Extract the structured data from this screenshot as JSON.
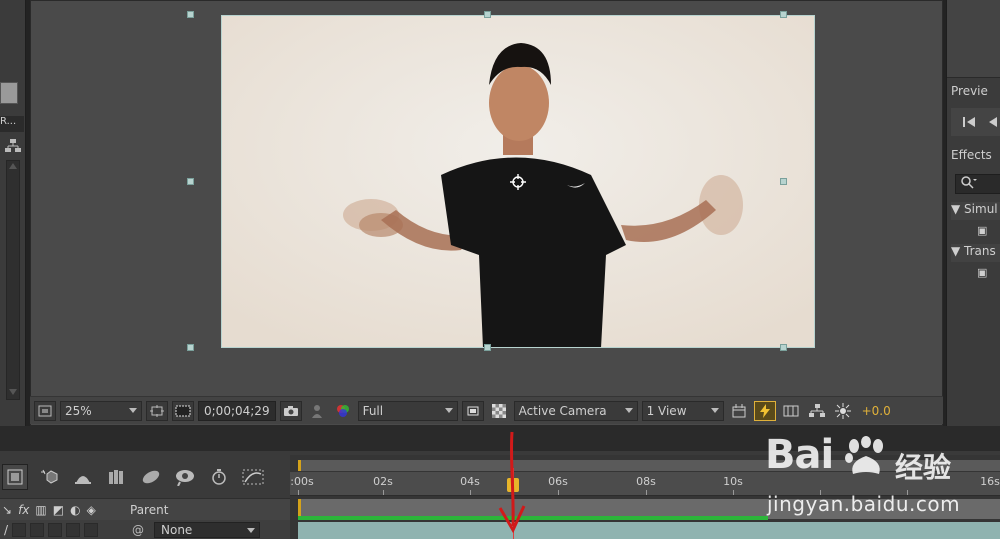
{
  "left_panel": {
    "column_label": "R...",
    "tree_icon": "hierarchy-icon"
  },
  "composition": {
    "anchor_icon": "anchor-point-icon",
    "toolbar": {
      "region_icon": "region-of-interest-icon",
      "zoom": "25%",
      "safe_zones_icon": "safe-zones-icon",
      "mask_icon": "mask-visibility-icon",
      "timecode": "0;00;04;29",
      "snapshot_icon": "camera-icon",
      "show_snapshot_icon": "person-icon",
      "channel_icon": "rgb-channels-icon",
      "resolution": "Full",
      "roi_icon": "region-icon",
      "transparency_icon": "transparency-grid-icon",
      "camera": "Active Camera",
      "views": "1 View",
      "toggle_pixel_icon": "pixel-aspect-icon",
      "fast_preview_icon": "lightning-icon",
      "timeline_icon": "timeline-icon",
      "flowchart_icon": "flowchart-icon",
      "exposure_icon": "exposure-icon",
      "exposure_value": "+0.0"
    }
  },
  "right_panel": {
    "preview_title": "Previe",
    "effects_title": "Effects",
    "search_icon": "search-icon",
    "groups": [
      {
        "label": "Simul"
      },
      {
        "label": "Trans"
      }
    ]
  },
  "timeline": {
    "tools": [
      "composition-mini-flowchart-icon",
      "draft-3d-icon",
      "shy-layers-icon",
      "frame-blending-icon",
      "motion-blur-icon",
      "brainstorm-icon",
      "graph-editor-icon"
    ],
    "parent_label": "Parent",
    "parent_value": "None",
    "ruler_labels": [
      ":00s",
      "02s",
      "04s",
      "06s",
      "08s",
      "10s",
      "16s"
    ],
    "fx_label": "fx"
  },
  "watermark": {
    "logo_text": "Bai",
    "logo_text2": "du",
    "chinese": "经验",
    "url": "jingyan.baidu.com"
  },
  "colors": {
    "accent_orange": "#e0b13a",
    "layer_green": "#2cb53a",
    "playhead_red": "#e04040"
  }
}
